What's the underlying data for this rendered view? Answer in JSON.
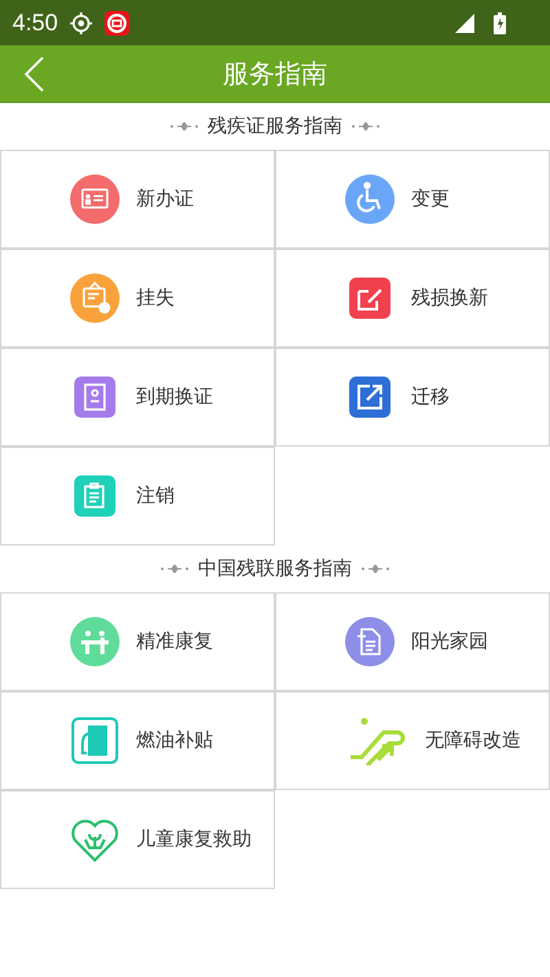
{
  "status_bar": {
    "time": "4:50"
  },
  "header": {
    "title": "服务指南"
  },
  "sections": [
    {
      "title": "残疾证服务指南",
      "items": [
        {
          "label": "新办证",
          "kind": "card",
          "color": "#f36b6b"
        },
        {
          "label": "变更",
          "kind": "wheelchair",
          "color": "#6aa6f8"
        },
        {
          "label": "挂失",
          "kind": "notice",
          "color": "#f9a23b"
        },
        {
          "label": "残损换新",
          "kind": "edit",
          "color": "#f2404e"
        },
        {
          "label": "到期换证",
          "kind": "book",
          "color": "#a57bec"
        },
        {
          "label": "迁移",
          "kind": "export",
          "color": "#2d6fd6"
        },
        {
          "label": "注销",
          "kind": "clipboard",
          "color": "#1ed1b8"
        }
      ]
    },
    {
      "title": "中国残联服务指南",
      "items": [
        {
          "label": "精准康复",
          "kind": "people",
          "color": "#5fdc9a"
        },
        {
          "label": "阳光家园",
          "kind": "document",
          "color": "#8c8ee8"
        },
        {
          "label": "燃油补贴",
          "kind": "fuel",
          "color": "#1ec9b8"
        },
        {
          "label": "无障碍改造",
          "kind": "escalator",
          "color": "#a9dc3a"
        },
        {
          "label": "儿童康复救助",
          "kind": "heart",
          "color": "#2bbf6c"
        }
      ]
    }
  ]
}
